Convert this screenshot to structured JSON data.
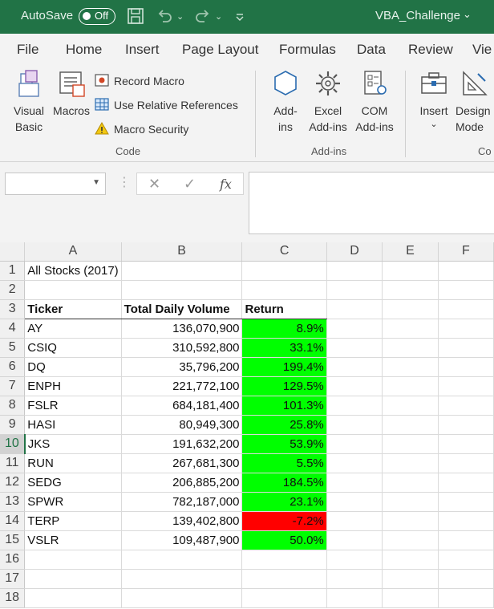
{
  "titlebar": {
    "autosave_label": "AutoSave",
    "autosave_state": "Off",
    "workbook_title": "VBA_Challenge",
    "title_chevron": "⌄"
  },
  "menu": {
    "tabs": [
      "File",
      "Home",
      "Insert",
      "Page Layout",
      "Formulas",
      "Data",
      "Review",
      "Vie"
    ]
  },
  "ribbon": {
    "code_group": {
      "visual_basic": [
        "Visual",
        "Basic"
      ],
      "macros": "Macros",
      "record_macro": "Record Macro",
      "relative_refs": "Use Relative References",
      "macro_security": "Macro Security",
      "label": "Code"
    },
    "addins_group": {
      "addins": [
        "Add-",
        "ins"
      ],
      "excel_addins": [
        "Excel",
        "Add-ins"
      ],
      "com_addins": [
        "COM",
        "Add-ins"
      ],
      "label": "Add-ins"
    },
    "controls_group": {
      "insert": "Insert",
      "insert_chevron": "⌄",
      "design_mode": [
        "Design",
        "Mode"
      ],
      "label": "Co"
    }
  },
  "formula_bar": {
    "namebox_value": "",
    "formula_value": "",
    "cancel_glyph": "✕",
    "enter_glyph": "✓",
    "fx_label": "fx"
  },
  "sheet": {
    "columns": [
      "A",
      "B",
      "C",
      "D",
      "E",
      "F"
    ],
    "selected_row": 10,
    "title_cell": "All Stocks (2017)",
    "headers": [
      "Ticker",
      "Total Daily Volume",
      "Return"
    ],
    "rows": [
      {
        "ticker": "AY",
        "volume": "136,070,900",
        "return": "8.9%",
        "positive": true
      },
      {
        "ticker": "CSIQ",
        "volume": "310,592,800",
        "return": "33.1%",
        "positive": true
      },
      {
        "ticker": "DQ",
        "volume": "35,796,200",
        "return": "199.4%",
        "positive": true
      },
      {
        "ticker": "ENPH",
        "volume": "221,772,100",
        "return": "129.5%",
        "positive": true
      },
      {
        "ticker": "FSLR",
        "volume": "684,181,400",
        "return": "101.3%",
        "positive": true
      },
      {
        "ticker": "HASI",
        "volume": "80,949,300",
        "return": "25.8%",
        "positive": true
      },
      {
        "ticker": "JKS",
        "volume": "191,632,200",
        "return": "53.9%",
        "positive": true
      },
      {
        "ticker": "RUN",
        "volume": "267,681,300",
        "return": "5.5%",
        "positive": true
      },
      {
        "ticker": "SEDG",
        "volume": "206,885,200",
        "return": "184.5%",
        "positive": true
      },
      {
        "ticker": "SPWR",
        "volume": "782,187,000",
        "return": "23.1%",
        "positive": true
      },
      {
        "ticker": "TERP",
        "volume": "139,402,800",
        "return": "-7.2%",
        "positive": false
      },
      {
        "ticker": "VSLR",
        "volume": "109,487,900",
        "return": "50.0%",
        "positive": true
      }
    ],
    "row_numbers": [
      "1",
      "2",
      "3",
      "4",
      "5",
      "6",
      "7",
      "8",
      "9",
      "10",
      "11",
      "12",
      "13",
      "14",
      "15",
      "16",
      "17",
      "18"
    ]
  },
  "colors": {
    "title_bar": "#217346",
    "positive_fill": "#00ff00",
    "negative_fill": "#ff0000"
  }
}
